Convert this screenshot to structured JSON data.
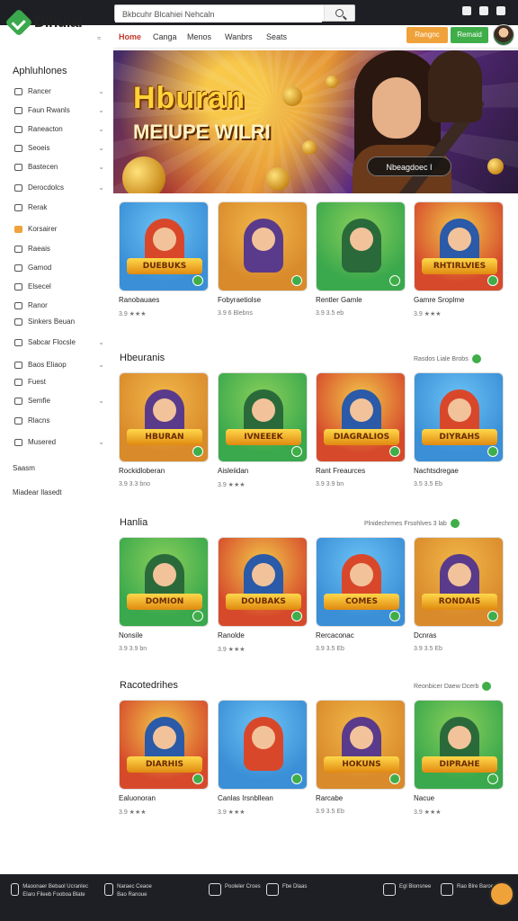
{
  "brand": {
    "name": "Dihuiar",
    "sup": "≈"
  },
  "search": {
    "value": "Bkbcuhr Blcahiei Nehcaln",
    "placeholder": ""
  },
  "nav": {
    "items": [
      "Home",
      "Canga",
      "Menos",
      "Wanbrs",
      "Seats"
    ],
    "active": "Home"
  },
  "header_buttons": {
    "orange": "Rangnc",
    "green": "Remaid"
  },
  "sidebar": {
    "title": "Aphluhlones",
    "items": [
      {
        "label": "Rancer",
        "icon": "grid-icon"
      },
      {
        "label": "Faun Rwanls",
        "icon": "tag-icon"
      },
      {
        "label": "Raneacton",
        "icon": "monitor-icon"
      },
      {
        "label": "Seoeis",
        "icon": "box-icon"
      },
      {
        "label": "Bastecen",
        "icon": "folder-icon"
      },
      {
        "label": "Derocdolcs",
        "icon": "chat-icon"
      },
      {
        "label": "Rerak",
        "icon": "clock-icon"
      },
      {
        "label": "Korsairer",
        "icon": "star-icon"
      },
      {
        "label": "Raeais",
        "icon": "gift-icon"
      },
      {
        "label": "Gamod",
        "icon": "controller-icon"
      },
      {
        "label": "Elsecel",
        "icon": "cross-icon"
      },
      {
        "label": "Ranor",
        "icon": "list-icon"
      },
      {
        "label": "Sinkers Beuan",
        "icon": "users-icon"
      },
      {
        "label": "Sabcar Flocsle",
        "icon": "screen-icon"
      },
      {
        "label": "Baos Eliaop",
        "icon": "calendar-icon"
      },
      {
        "label": "Fuest",
        "icon": "trophy-icon"
      },
      {
        "label": "Semfie",
        "icon": "edit-icon"
      },
      {
        "label": "Rlacns",
        "icon": "folder-icon"
      },
      {
        "label": "Musered",
        "icon": "inbox-icon"
      }
    ],
    "extras": [
      "Saasm",
      "Miadear Ilasedt"
    ]
  },
  "hero": {
    "title": "Hburan",
    "subtitle": "MEIUPE WILRI",
    "cta": "Nbeagdoec I"
  },
  "sections": [
    {
      "title": "",
      "link": "",
      "cards": [
        {
          "title": "Ranobauaes",
          "meta": "3.9 ★★★",
          "banner": "DUEBUKS"
        },
        {
          "title": "Fobyraetiolse",
          "meta": "3.9 6 Blebns",
          "banner": ""
        },
        {
          "title": "Rentler Gamle",
          "meta": "3.9 3.5 eb",
          "banner": ""
        },
        {
          "title": "Gamre Sroplme",
          "meta": "3.9 ★★★",
          "banner": "RHTIRLVIES"
        }
      ]
    },
    {
      "title": "Hbeuranis",
      "link": "Rasdos Liale Brobs",
      "cards": [
        {
          "title": "Rockidloberan",
          "meta": "3.9 3.3 bno",
          "banner": "HBURAN"
        },
        {
          "title": "Aisleiidan",
          "meta": "3.9 ★★★",
          "banner": "IVNEEEK"
        },
        {
          "title": "Rant Freaurces",
          "meta": "3.9 3.9 bn",
          "banner": "DIAGRALIOS"
        },
        {
          "title": "Nachtsdregae",
          "meta": "3.5 3.5 Eb",
          "banner": "DIYRAHS"
        }
      ]
    },
    {
      "title": "Hanlia",
      "link": "Plnidechrmes Frsohlves 3 lab",
      "cards": [
        {
          "title": "Nonsile",
          "meta": "3.9 3.9 bn",
          "banner": "DOMION"
        },
        {
          "title": "Ranolde",
          "meta": "3.9 ★★★",
          "banner": "DOUBAKS"
        },
        {
          "title": "Rercaconac",
          "meta": "3.9 3.5 Eb",
          "banner": "COMES"
        },
        {
          "title": "Dcnras",
          "meta": "3.9 3.5 Eb",
          "banner": "RONDAIS"
        }
      ]
    },
    {
      "title": "Racotedrihes",
      "link": "Reonbicer Daew Dcerb",
      "cards": [
        {
          "title": "Ealuonoran",
          "meta": "3.9 ★★★",
          "banner": "DIARHIS"
        },
        {
          "title": "Canlas Irsnbllean",
          "meta": "3.9 ★★★",
          "banner": ""
        },
        {
          "title": "Rarcabe",
          "meta": "3.9 3.5 Eb",
          "banner": "HOKUNS"
        },
        {
          "title": "Nacue",
          "meta": "3.9 ★★★",
          "banner": "DIPRAHE"
        }
      ]
    }
  ],
  "footer": {
    "items": [
      {
        "label": "Maoonaer Bebaol Ucranlec Elaro Fileeb Fooboa Blate",
        "icon": "window-icon"
      },
      {
        "label": "Naraec Ceaoe Bao Ranoue",
        "icon": "globe-icon"
      },
      {
        "label": "Pooleler Croes",
        "icon": "user-icon"
      },
      {
        "label": "Fbe Dlaas",
        "icon": "app-icon"
      },
      {
        "label": "Egl Bionsnee",
        "icon": "bag-icon"
      },
      {
        "label": "Rao Blre Baroe",
        "icon": "send-icon"
      }
    ]
  },
  "colors": {
    "accent": "#3fae49",
    "orange": "#f0a23a",
    "active_nav": "#c0392b",
    "dark": "#1e1f24"
  }
}
